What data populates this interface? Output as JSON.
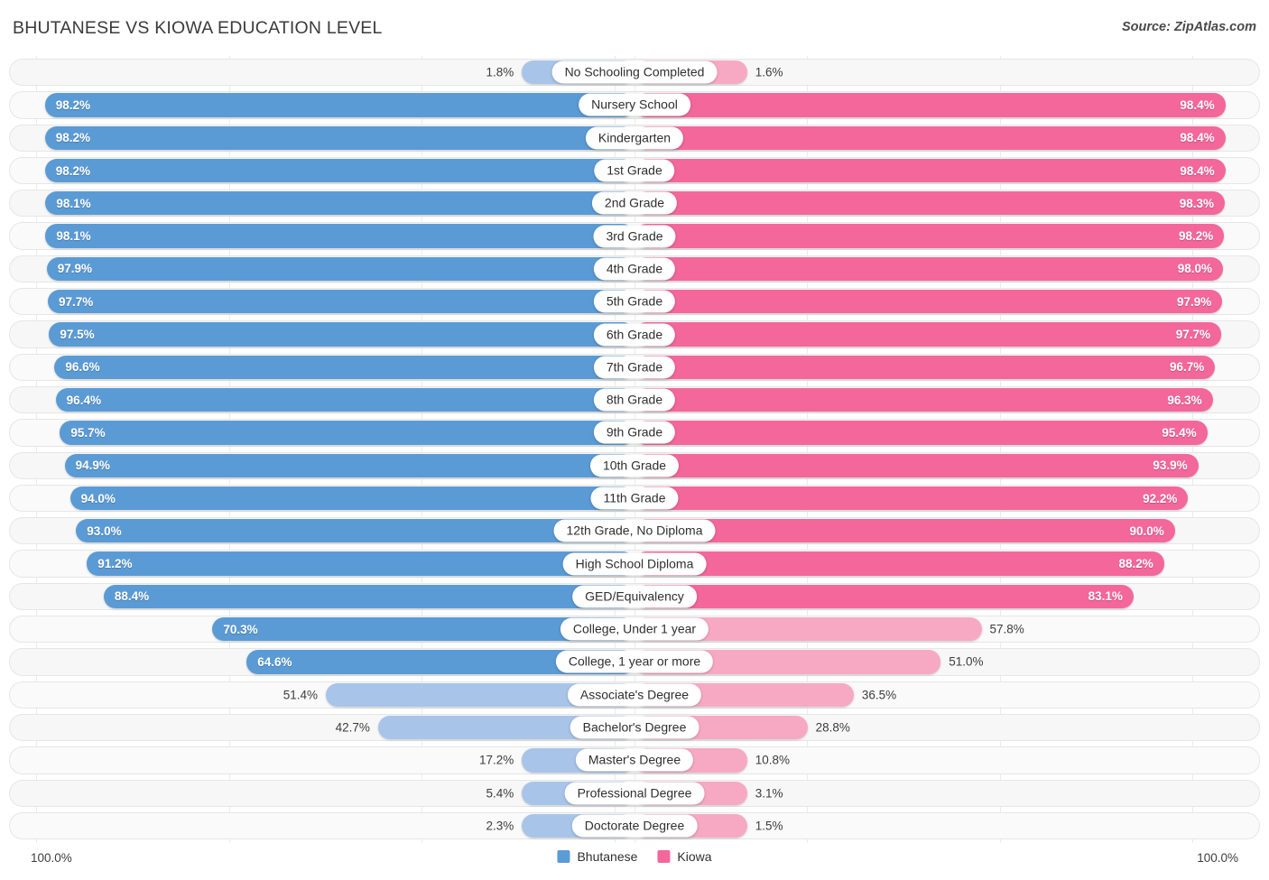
{
  "header": {
    "title": "BHUTANESE VS KIOWA EDUCATION LEVEL",
    "source": "Source: ZipAtlas.com"
  },
  "footer": {
    "axis_left": "100.0%",
    "axis_right": "100.0%",
    "legend": [
      {
        "label": "Bhutanese",
        "color": "#5b9bd5"
      },
      {
        "label": "Kiowa",
        "color": "#f4679a"
      }
    ]
  },
  "colors": {
    "blue_strong": "#5b9bd5",
    "blue_light": "#a8c5e9",
    "pink_strong": "#f4679a",
    "pink_light": "#f7a9c4",
    "track": "#f7f7f7",
    "track_border": "#e6e6e6"
  },
  "chart_data": {
    "type": "bar",
    "title": "BHUTANESE VS KIOWA EDUCATION LEVEL",
    "subtitle": "Source: ZipAtlas.com",
    "orientation": "horizontal-diverging",
    "xlabel": "",
    "ylabel": "",
    "xlim": [
      0,
      100
    ],
    "axis_left_max": "100.0%",
    "axis_right_max": "100.0%",
    "grid": true,
    "legend_position": "bottom-center",
    "categories": [
      "No Schooling Completed",
      "Nursery School",
      "Kindergarten",
      "1st Grade",
      "2nd Grade",
      "3rd Grade",
      "4th Grade",
      "5th Grade",
      "6th Grade",
      "7th Grade",
      "8th Grade",
      "9th Grade",
      "10th Grade",
      "11th Grade",
      "12th Grade, No Diploma",
      "High School Diploma",
      "GED/Equivalency",
      "College, Under 1 year",
      "College, 1 year or more",
      "Associate's Degree",
      "Bachelor's Degree",
      "Master's Degree",
      "Professional Degree",
      "Doctorate Degree"
    ],
    "series": [
      {
        "name": "Bhutanese",
        "color": "#5b9bd5",
        "values": [
          1.8,
          98.2,
          98.2,
          98.2,
          98.1,
          98.1,
          97.9,
          97.7,
          97.5,
          96.6,
          96.4,
          95.7,
          94.9,
          94.0,
          93.0,
          91.2,
          88.4,
          70.3,
          64.6,
          51.4,
          42.7,
          17.2,
          5.4,
          2.3
        ],
        "labels": [
          "1.8%",
          "98.2%",
          "98.2%",
          "98.2%",
          "98.1%",
          "98.1%",
          "97.9%",
          "97.7%",
          "97.5%",
          "96.6%",
          "96.4%",
          "95.7%",
          "94.9%",
          "94.0%",
          "93.0%",
          "91.2%",
          "88.4%",
          "70.3%",
          "64.6%",
          "51.4%",
          "42.7%",
          "17.2%",
          "5.4%",
          "2.3%"
        ]
      },
      {
        "name": "Kiowa",
        "color": "#f4679a",
        "values": [
          1.6,
          98.4,
          98.4,
          98.4,
          98.3,
          98.2,
          98.0,
          97.9,
          97.7,
          96.7,
          96.3,
          95.4,
          93.9,
          92.2,
          90.0,
          88.2,
          83.1,
          57.8,
          51.0,
          36.5,
          28.8,
          10.8,
          3.1,
          1.5
        ],
        "labels": [
          "1.6%",
          "98.4%",
          "98.4%",
          "98.4%",
          "98.3%",
          "98.2%",
          "98.0%",
          "97.9%",
          "97.7%",
          "96.7%",
          "96.3%",
          "95.4%",
          "93.9%",
          "92.2%",
          "90.0%",
          "88.2%",
          "83.1%",
          "57.8%",
          "51.0%",
          "36.5%",
          "28.8%",
          "10.8%",
          "3.1%",
          "1.5%"
        ]
      }
    ]
  }
}
